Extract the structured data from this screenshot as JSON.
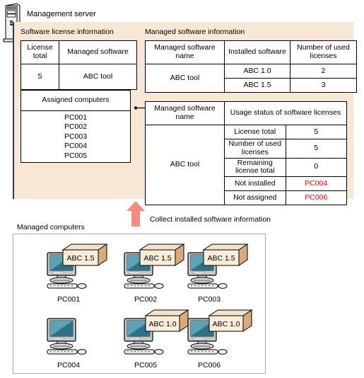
{
  "server": {
    "label": "Management server",
    "icon": "server-tower-icon",
    "panel_bg": "#f9e7d6"
  },
  "left_section": {
    "caption": "Software license information",
    "license_table": {
      "headers": [
        "License total",
        "Managed software"
      ],
      "rows": [
        [
          "5",
          "ABC tool"
        ]
      ]
    },
    "assigned_table": {
      "header": "Assigned computers",
      "computers": [
        "PC001",
        "PC002",
        "PC003",
        "PC004",
        "PC005"
      ]
    }
  },
  "right_section": {
    "caption": "Managed software information",
    "installed_table": {
      "headers": [
        "Managed software name",
        "Installed software",
        "Number of used licenses"
      ],
      "software_name": "ABC tool",
      "rows": [
        {
          "installed": "ABC 1.0",
          "used": "2"
        },
        {
          "installed": "ABC 1.5",
          "used": "3"
        }
      ]
    },
    "usage_table": {
      "headers": [
        "Managed software name",
        "Usage status of software licenses"
      ],
      "software_name": "ABC tool",
      "rows": [
        {
          "label": "License total",
          "value": "5",
          "alert": false
        },
        {
          "label": "Number of used licenses",
          "value": "5",
          "alert": false
        },
        {
          "label": "Remaining license total",
          "value": "0",
          "alert": false
        },
        {
          "label": "Not installed",
          "value": "PC004",
          "alert": true
        },
        {
          "label": "Not assigned",
          "value": "PC006",
          "alert": true
        }
      ]
    }
  },
  "flow": {
    "arrow_label": "Collect installed software information",
    "arrow_color": "#f48c80"
  },
  "computers_section": {
    "caption": "Managed computers",
    "computers": [
      {
        "name": "PC001",
        "software": "ABC 1.5",
        "has_software": true
      },
      {
        "name": "PC002",
        "software": "ABC 1.5",
        "has_software": true
      },
      {
        "name": "PC003",
        "software": "ABC 1.5",
        "has_software": true
      },
      {
        "name": "PC004",
        "software": "",
        "has_software": false
      },
      {
        "name": "PC005",
        "software": "ABC 1.0",
        "has_software": true
      },
      {
        "name": "PC006",
        "software": "ABC 1.0",
        "has_software": true
      }
    ]
  },
  "colors": {
    "panel": "#f9e7d6",
    "alert_text": "#ff0000",
    "arrow": "#f48c80",
    "box_front": "#f6e0c8",
    "box_side": "#d8ab7c",
    "screen": "#2e7287"
  }
}
